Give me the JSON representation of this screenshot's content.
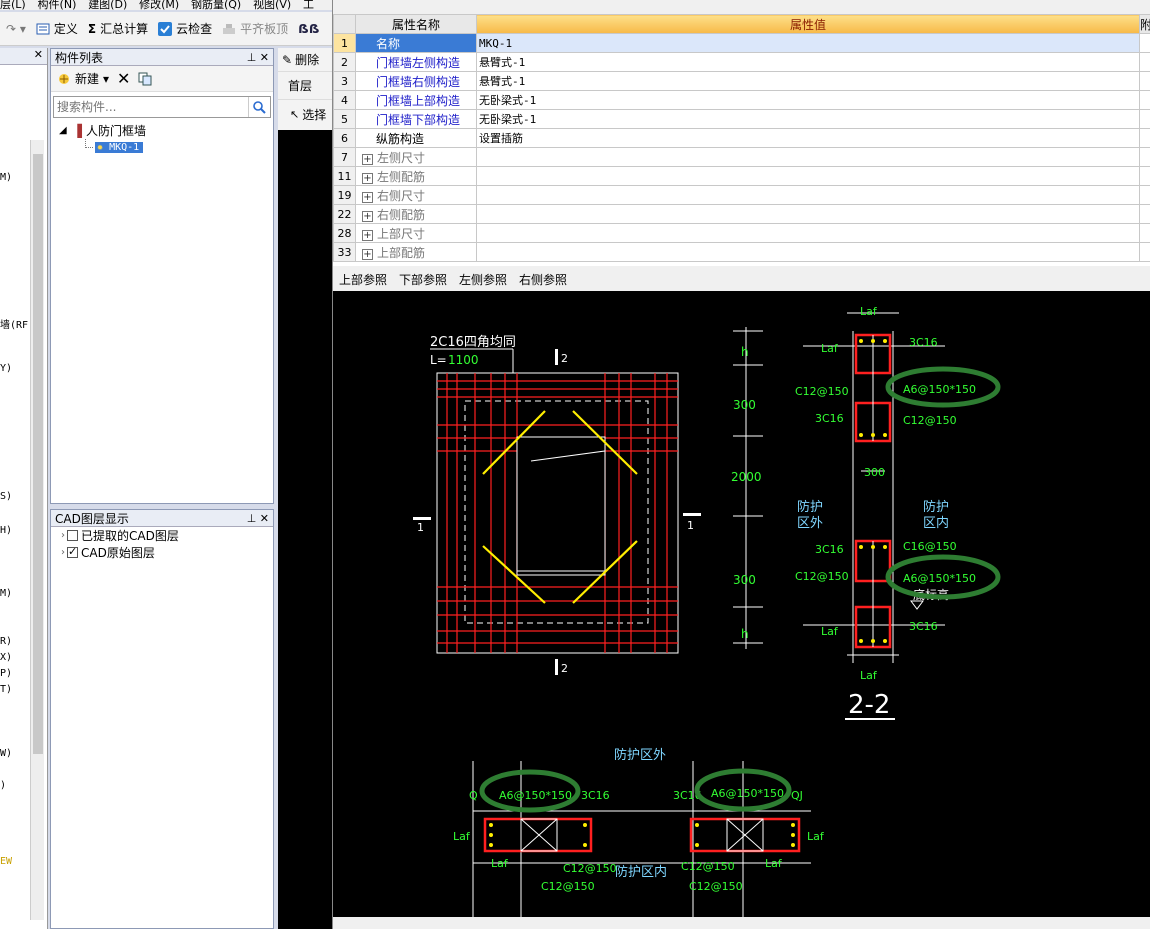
{
  "menubar": {
    "items": [
      "层(L)",
      "构件(N)",
      "建图(D)",
      "修改(M)",
      "钢筋量(Q)",
      "视图(V)",
      "工具"
    ]
  },
  "toolbar": {
    "define_label": "定义",
    "sum_label": "汇总计算",
    "cloud_check_label": "云检查",
    "flush_label": "平齐板顶"
  },
  "mid_toolbar": {
    "delete_label": "删除",
    "floor_label": "首层",
    "select_label": "选择"
  },
  "left_edge": {
    "labels": [
      "M)",
      "墙(RF",
      "Y)",
      "S)",
      "H)",
      "M)",
      "R)",
      "X)",
      "P)",
      "T)",
      "W)",
      ")",
      "EW"
    ]
  },
  "component_list": {
    "title": "构件列表",
    "new_label": "新建",
    "search_placeholder": "搜索构件...",
    "tree": {
      "group": "人防门框墙",
      "item": "MKQ-1"
    }
  },
  "cad_layers": {
    "title": "CAD图层显示",
    "rows": [
      {
        "label": "已提取的CAD图层",
        "checked": false
      },
      {
        "label": "CAD原始图层",
        "checked": true
      }
    ]
  },
  "property_table": {
    "headers": {
      "name": "属性名称",
      "value": "属性值",
      "extra": "附"
    },
    "rows": [
      {
        "idx": "1",
        "name": "名称",
        "value": "MKQ-1",
        "style": "selected"
      },
      {
        "idx": "2",
        "name": "门框墙左侧构造",
        "value": "悬臂式-1",
        "style": "link"
      },
      {
        "idx": "3",
        "name": "门框墙右侧构造",
        "value": "悬臂式-1",
        "style": "link"
      },
      {
        "idx": "4",
        "name": "门框墙上部构造",
        "value": "无卧梁式-1",
        "style": "link"
      },
      {
        "idx": "5",
        "name": "门框墙下部构造",
        "value": "无卧梁式-1",
        "style": "link"
      },
      {
        "idx": "6",
        "name": "纵筋构造",
        "value": "设置插筋",
        "style": "plain"
      },
      {
        "idx": "7",
        "name": "左侧尺寸",
        "value": "",
        "style": "group"
      },
      {
        "idx": "11",
        "name": "左侧配筋",
        "value": "",
        "style": "group"
      },
      {
        "idx": "19",
        "name": "右侧尺寸",
        "value": "",
        "style": "group"
      },
      {
        "idx": "22",
        "name": "右侧配筋",
        "value": "",
        "style": "group"
      },
      {
        "idx": "28",
        "name": "上部尺寸",
        "value": "",
        "style": "group"
      },
      {
        "idx": "33",
        "name": "上部配筋",
        "value": "",
        "style": "group"
      }
    ]
  },
  "reference_tabs": [
    "上部参照",
    "下部参照",
    "左侧参照",
    "右侧参照"
  ],
  "drawing": {
    "plan": {
      "note_a": "2C16四角均同",
      "note_b_prefix": "L=",
      "note_b_value": "1100",
      "sec_mark_2": "2",
      "sec_mark_1": "1"
    },
    "section": {
      "dims": [
        "h",
        "300",
        "2000",
        "300",
        "h"
      ],
      "laf": "Laf",
      "c3c16": "3C16",
      "c12": "C12@150",
      "a6": "A6@150*150",
      "c16": "C16@150",
      "mid300": "300",
      "outside": "防护\n区外",
      "outside_l1": "防护",
      "outside_l2": "区外",
      "inside_l1": "防护",
      "inside_l2": "区内",
      "base": "底标高",
      "title": "2-2"
    },
    "bottom": {
      "outside": "防护区外",
      "inside": "防护区内",
      "qi": "Q",
      "qj": "QJ"
    },
    "colors": {
      "red": "#ff2020",
      "yellow": "#ffee00",
      "green": "#33ff33",
      "cyan": "#7fd6ff",
      "highlight": "#2e7d32"
    }
  }
}
